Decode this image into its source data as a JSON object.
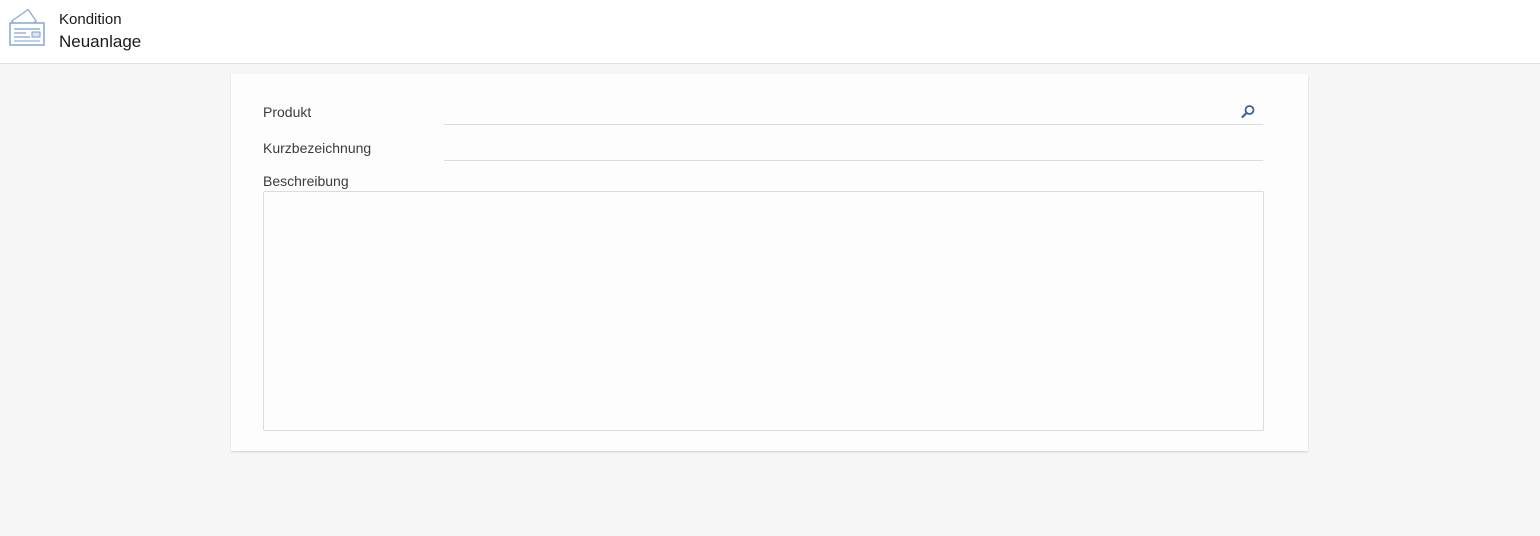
{
  "header": {
    "subtitle": "Kondition",
    "title": "Neuanlage",
    "icon": "document-card-icon"
  },
  "form": {
    "produkt": {
      "label": "Produkt",
      "value": "",
      "search_icon": "search-icon"
    },
    "kurzbezeichnung": {
      "label": "Kurzbezeichnung",
      "value": ""
    },
    "beschreibung": {
      "label": "Beschreibung",
      "value": ""
    }
  },
  "colors": {
    "accent": "#3b5ea8",
    "icon_stroke": "#7f9fcf"
  }
}
